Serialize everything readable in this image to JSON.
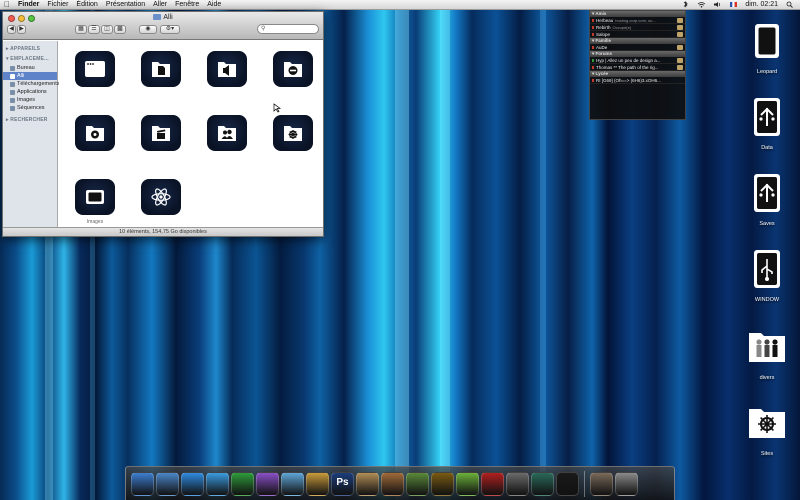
{
  "menubar": {
    "app_name": "Finder",
    "items": [
      "Fichier",
      "Édition",
      "Présentation",
      "Aller",
      "Fenêtre",
      "Aide"
    ],
    "clock": "dim. 02:21"
  },
  "finder": {
    "title": "Alli",
    "search_placeholder": "",
    "sidebar": {
      "sections": [
        {
          "title": "▸ APPAREILS",
          "items": []
        },
        {
          "title": "▾ EMPLACEME...",
          "items": [
            {
              "label": "Bureau",
              "selected": false
            },
            {
              "label": "Alli",
              "selected": true
            },
            {
              "label": "Téléchargements",
              "selected": false
            },
            {
              "label": "Applications",
              "selected": false
            },
            {
              "label": "Images",
              "selected": false
            },
            {
              "label": "Séquences",
              "selected": false
            }
          ]
        },
        {
          "title": "▸ RECHERCHER",
          "items": []
        }
      ]
    },
    "icons": [
      {
        "name": "window-folder-icon",
        "label": ""
      },
      {
        "name": "document-folder-icon",
        "label": ""
      },
      {
        "name": "speaker-folder-icon",
        "label": ""
      },
      {
        "name": "minus-folder-icon",
        "label": ""
      },
      {
        "name": "gear-folder-icon",
        "label": ""
      },
      {
        "name": "clapper-folder-icon",
        "label": ""
      },
      {
        "name": "users-folder-icon",
        "label": ""
      },
      {
        "name": "helm-folder-icon",
        "label": ""
      },
      {
        "name": "monitor-folder-icon",
        "label": "Images"
      },
      {
        "name": "atom-folder-icon",
        "label": ""
      }
    ],
    "status": "10 éléments, 154,75 Go disponibles"
  },
  "widget": {
    "sections": [
      {
        "title": "▾ Amis",
        "rows": [
          {
            "text": "Herbeau",
            "sub": "hosting-corp.com, so..."
          },
          {
            "text": "Rebirth",
            "sub": "Occupé(e)"
          },
          {
            "text": "Salope",
            "sub": ""
          }
        ]
      },
      {
        "title": "▾ Famille",
        "rows": [
          {
            "text": "AuDe",
            "sub": ""
          }
        ]
      },
      {
        "title": "▾ Forums",
        "rows": [
          {
            "text": "Hyp | Allez un peu de design a...",
            "sub": ""
          },
          {
            "text": "Thomas ** The path of the rig...",
            "sub": ""
          }
        ]
      },
      {
        "title": "▾ Lycée",
        "rows": [
          {
            "text": "RI [G69] (Oh==> (6H6)3.xOH6...",
            "sub": ""
          }
        ]
      }
    ]
  },
  "desktop": {
    "icons": [
      {
        "name": "leopard-drive",
        "label": "Leopard"
      },
      {
        "name": "data-drive",
        "label": "Data"
      },
      {
        "name": "saves-drive",
        "label": "Saves"
      },
      {
        "name": "window-usb-drive",
        "label": "WINDOW"
      },
      {
        "name": "divers-folder",
        "label": "divers"
      },
      {
        "name": "sites-folder",
        "label": "Sites"
      }
    ]
  },
  "dock": {
    "apps": [
      {
        "name": "finder",
        "color": "#3d7fd1"
      },
      {
        "name": "preview",
        "color": "#4a86c8"
      },
      {
        "name": "safari",
        "color": "#2f8be0"
      },
      {
        "name": "ichat",
        "color": "#3a9be0"
      },
      {
        "name": "adium",
        "color": "#2e9b3a"
      },
      {
        "name": "itunes",
        "color": "#8a4fc6"
      },
      {
        "name": "itunes-music",
        "color": "#5fa6d9"
      },
      {
        "name": "iphoto",
        "color": "#c89a3a"
      },
      {
        "name": "photoshop",
        "color": "#1c3d7a"
      },
      {
        "name": "address-book",
        "color": "#b08d56"
      },
      {
        "name": "installer",
        "color": "#a06a3a"
      },
      {
        "name": "automator",
        "color": "#5a8a3a"
      },
      {
        "name": "world-of-warcraft",
        "color": "#7a5a12"
      },
      {
        "name": "ball-app",
        "color": "#6ab03a"
      },
      {
        "name": "movie-app",
        "color": "#b02020"
      },
      {
        "name": "system-preferences",
        "color": "#6a6a6a"
      },
      {
        "name": "time-machine",
        "color": "#2a6a5a"
      },
      {
        "name": "terminal",
        "color": "#1a1a1a"
      }
    ],
    "right_apps": [
      {
        "name": "photo-stack",
        "color": "#7a6a5a"
      },
      {
        "name": "trash",
        "color": "#8a8a8a"
      }
    ]
  }
}
